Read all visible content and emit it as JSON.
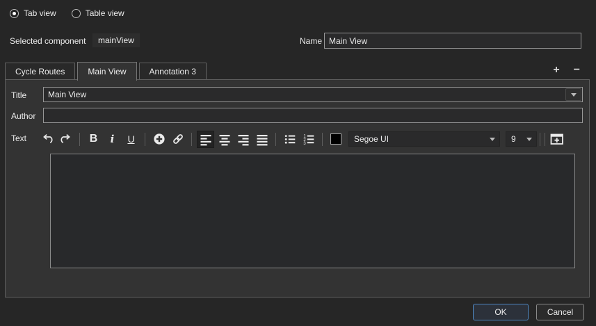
{
  "view_toggle": {
    "options": [
      {
        "label": "Tab view",
        "selected": true
      },
      {
        "label": "Table view",
        "selected": false
      }
    ]
  },
  "component_bar": {
    "label": "Selected component",
    "value": "mainView",
    "name_label": "Name",
    "name_value": "Main View"
  },
  "tabs": {
    "items": [
      {
        "label": "Cycle Routes",
        "active": false
      },
      {
        "label": "Main View",
        "active": true
      },
      {
        "label": "Annotation 3",
        "active": false
      }
    ],
    "add_glyph": "+",
    "remove_glyph": "−"
  },
  "form": {
    "title_label": "Title",
    "title_value": "Main View",
    "author_label": "Author",
    "author_value": "",
    "text_label": "Text"
  },
  "toolbar": {
    "bold_glyph": "B",
    "italic_glyph": "i",
    "underline_glyph": "U",
    "font_color": "#000000",
    "font_name": "Segoe UI",
    "font_size": "9",
    "active_button": "align-left",
    "icons": [
      "undo",
      "redo",
      "bold",
      "italic",
      "underline",
      "insert-symbol",
      "hyperlink",
      "align-left",
      "align-center",
      "align-right",
      "align-justify",
      "bullet-list",
      "numbered-list",
      "font-color",
      "font-family",
      "font-size",
      "insert-table"
    ]
  },
  "editor": {
    "content": ""
  },
  "footer": {
    "ok_label": "OK",
    "cancel_label": "Cancel"
  },
  "colors": {
    "accent": "#4e86c0",
    "panel_bg": "#333333",
    "page_bg": "#262626"
  }
}
